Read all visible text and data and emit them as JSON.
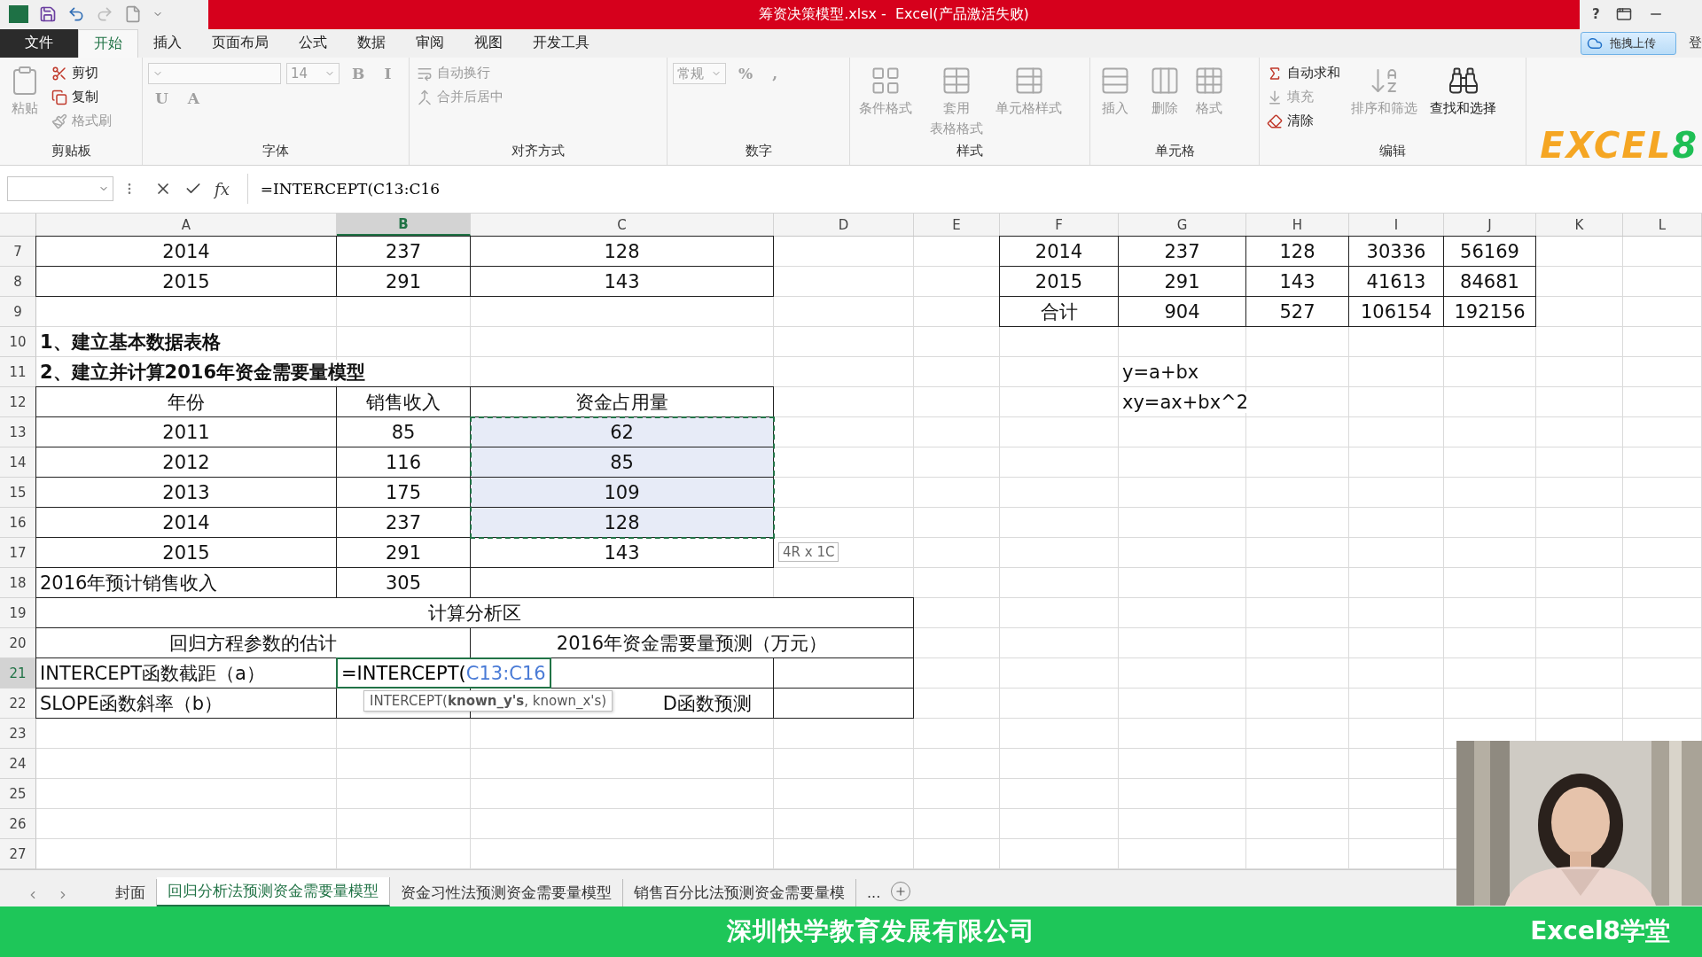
{
  "title_bar": {
    "title": "筹资决策模型.xlsx -  Excel(产品激活失败)",
    "help": "?"
  },
  "menu_tabs": [
    {
      "label": "文件",
      "kind": "file",
      "selected": false
    },
    {
      "label": "开始",
      "kind": "tab",
      "selected": true
    },
    {
      "label": "插入",
      "kind": "tab",
      "selected": false
    },
    {
      "label": "页面布局",
      "kind": "tab",
      "selected": false
    },
    {
      "label": "公式",
      "kind": "tab",
      "selected": false
    },
    {
      "label": "数据",
      "kind": "tab",
      "selected": false
    },
    {
      "label": "审阅",
      "kind": "tab",
      "selected": false
    },
    {
      "label": "视图",
      "kind": "tab",
      "selected": false
    },
    {
      "label": "开发工具",
      "kind": "tab",
      "selected": false
    }
  ],
  "upload_button": "拖拽上传",
  "account": "登",
  "ribbon": [
    {
      "label": "剪贴板",
      "items": [
        {
          "kind": "large",
          "lines": [
            "粘贴"
          ],
          "disabled": true
        },
        {
          "kind": "small",
          "label": "剪切",
          "disabled": false
        },
        {
          "kind": "small",
          "label": "复制",
          "disabled": false
        },
        {
          "kind": "small",
          "label": "格式刷",
          "disabled": true
        }
      ]
    },
    {
      "label": "字体",
      "items": [
        {
          "kind": "combo",
          "disabled": true
        },
        {
          "kind": "combo",
          "value": "14",
          "disabled": true
        },
        {
          "kind": "glyph",
          "label": "B",
          "disabled": true
        },
        {
          "kind": "glyph",
          "label": "I",
          "disabled": true
        },
        {
          "kind": "glyph",
          "label": "U",
          "disabled": true
        },
        {
          "kind": "glyph",
          "label": "A",
          "disabled": true
        }
      ]
    },
    {
      "label": "对齐方式",
      "items": [
        {
          "kind": "small",
          "label": "自动换行",
          "disabled": true
        },
        {
          "kind": "small",
          "label": "合并后居中",
          "disabled": true
        }
      ]
    },
    {
      "label": "数字",
      "items": [
        {
          "kind": "combo",
          "value": "常规",
          "disabled": true
        },
        {
          "kind": "glyph",
          "label": "%",
          "disabled": true
        },
        {
          "kind": "glyph",
          "label": ",",
          "disabled": true
        }
      ]
    },
    {
      "label": "样式",
      "items": [
        {
          "kind": "large",
          "lines": [
            "条件格式"
          ],
          "disabled": true
        },
        {
          "kind": "large",
          "lines": [
            "套用",
            "表格格式"
          ],
          "disabled": true
        },
        {
          "kind": "large",
          "lines": [
            "单元格样式"
          ],
          "disabled": true
        }
      ]
    },
    {
      "label": "单元格",
      "items": [
        {
          "kind": "large",
          "lines": [
            "插入"
          ],
          "disabled": true
        },
        {
          "kind": "large",
          "lines": [
            "删除"
          ],
          "disabled": true
        },
        {
          "kind": "large",
          "lines": [
            "格式"
          ],
          "disabled": true
        }
      ]
    },
    {
      "label": "编辑",
      "items": [
        {
          "kind": "small",
          "label": "自动求和",
          "disabled": false
        },
        {
          "kind": "small",
          "label": "填充",
          "disabled": true
        },
        {
          "kind": "small",
          "label": "清除",
          "disabled": false
        },
        {
          "kind": "large",
          "lines": [
            "排序和筛选"
          ],
          "disabled": true
        },
        {
          "kind": "large",
          "lines": [
            "查找和选择"
          ],
          "disabled": false
        }
      ]
    }
  ],
  "logo": {
    "text": "EXCEL",
    "accent": "8"
  },
  "formula_bar": {
    "fx": "fx",
    "formula": "=INTERCEPT(C13:C16"
  },
  "sheet": {
    "columns": [
      {
        "label": "A",
        "selected": false
      },
      {
        "label": "B",
        "selected": true
      },
      {
        "label": "C",
        "selected": false
      },
      {
        "label": "D",
        "selected": false
      },
      {
        "label": "E",
        "selected": false
      },
      {
        "label": "F",
        "selected": false
      },
      {
        "label": "G",
        "selected": false
      },
      {
        "label": "H",
        "selected": false
      },
      {
        "label": "I",
        "selected": false
      },
      {
        "label": "J",
        "selected": false
      },
      {
        "label": "K",
        "selected": false
      },
      {
        "label": "L",
        "selected": false
      }
    ],
    "rows": [
      {
        "number": "7",
        "selected": false,
        "cells": [
          {
            "text": "2014",
            "bordered": true
          },
          {
            "text": "237",
            "bordered": true
          },
          {
            "text": "128",
            "bordered": true
          },
          {
            "bordered": false
          },
          {
            "bordered": false
          },
          {
            "text": "2014",
            "bordered": true
          },
          {
            "text": "237",
            "bordered": true
          },
          {
            "text": "128",
            "bordered": true
          },
          {
            "text": "30336",
            "bordered": true
          },
          {
            "text": "56169",
            "bordered": true
          }
        ]
      },
      {
        "number": "8",
        "selected": false,
        "cells": [
          {
            "text": "2015",
            "bordered": true
          },
          {
            "text": "291",
            "bordered": true
          },
          {
            "text": "143",
            "bordered": true
          },
          {
            "bordered": false
          },
          {
            "bordered": false
          },
          {
            "text": "2015",
            "bordered": true
          },
          {
            "text": "291",
            "bordered": true
          },
          {
            "text": "143",
            "bordered": true
          },
          {
            "text": "41613",
            "bordered": true
          },
          {
            "text": "84681",
            "bordered": true
          }
        ]
      },
      {
        "number": "9",
        "selected": false,
        "cells": [
          {
            "bordered": false
          },
          {
            "bordered": false
          },
          {
            "bordered": false
          },
          {
            "bordered": false
          },
          {
            "bordered": false
          },
          {
            "text": "合计",
            "bordered": true
          },
          {
            "text": "904",
            "bordered": true
          },
          {
            "text": "527",
            "bordered": true
          },
          {
            "text": "106154",
            "bordered": true
          },
          {
            "text": "192156",
            "bordered": true
          }
        ]
      },
      {
        "number": "10",
        "selected": false,
        "cells": [
          {
            "text": "1、建立基本数据表格",
            "left_aligned": true,
            "bold": true
          }
        ]
      },
      {
        "number": "11",
        "selected": false,
        "cells": [
          {
            "text": "2、建立并计算2016年资金需要量模型",
            "left_aligned": true,
            "bold": true
          },
          {
            "bordered": false
          },
          {
            "bordered": false
          },
          {
            "bordered": false
          },
          {
            "bordered": false
          },
          {
            "bordered": false
          },
          {
            "text": "y=a+bx",
            "left_aligned": true
          }
        ]
      },
      {
        "number": "12",
        "selected": false,
        "cells": [
          {
            "text": "年份",
            "bordered": true
          },
          {
            "text": "销售收入",
            "bordered": true
          },
          {
            "text": "资金占用量",
            "bordered": true
          },
          {
            "bordered": false
          },
          {
            "bordered": false
          },
          {
            "bordered": false
          },
          {
            "text": "xy=ax+bx^2",
            "left_aligned": true
          }
        ]
      },
      {
        "number": "13",
        "selected": false,
        "cells": [
          {
            "text": "2011",
            "bordered": true
          },
          {
            "text": "85",
            "bordered": true
          },
          {
            "text": "62",
            "bordered": true,
            "highlighted": true
          }
        ]
      },
      {
        "number": "14",
        "selected": false,
        "cells": [
          {
            "text": "2012",
            "bordered": true
          },
          {
            "text": "116",
            "bordered": true
          },
          {
            "text": "85",
            "bordered": true,
            "highlighted": true
          }
        ]
      },
      {
        "number": "15",
        "selected": false,
        "cells": [
          {
            "text": "2013",
            "bordered": true
          },
          {
            "text": "175",
            "bordered": true
          },
          {
            "text": "109",
            "bordered": true,
            "highlighted": true
          }
        ]
      },
      {
        "number": "16",
        "selected": false,
        "cells": [
          {
            "text": "2014",
            "bordered": true
          },
          {
            "text": "237",
            "bordered": true
          },
          {
            "text": "128",
            "bordered": true,
            "highlighted": true
          }
        ]
      },
      {
        "number": "17",
        "selected": false,
        "cells": [
          {
            "text": "2015",
            "bordered": true
          },
          {
            "text": "291",
            "bordered": true
          },
          {
            "text": "143",
            "bordered": true
          }
        ]
      },
      {
        "number": "18",
        "selected": false,
        "cells": [
          {
            "text": "2016年预计销售收入",
            "left_aligned": true,
            "bordered": true
          },
          {
            "text": "305",
            "bordered": true
          }
        ]
      },
      {
        "number": "19",
        "selected": false,
        "cells": [
          {
            "text": "计算分析区",
            "bordered": true
          },
          {
            "covered": true
          },
          {
            "covered": true
          },
          {
            "covered": true
          }
        ]
      },
      {
        "number": "20",
        "selected": false,
        "cells": [
          {
            "text": "回归方程参数的估计",
            "bordered": true
          },
          {
            "covered": true
          },
          {
            "text": "2016年资金需要量预测（万元）",
            "bordered": true
          },
          {
            "covered": true
          }
        ]
      },
      {
        "number": "21",
        "selected": true,
        "cells": [
          {
            "text": "INTERCEPT函数截距（a）",
            "left_aligned": true,
            "bordered": true
          },
          {
            "kind": "editing",
            "text": "=INTERCEPT(",
            "reference": "C13:C16"
          },
          {
            "bordered": false
          },
          {
            "bordered": true
          }
        ]
      },
      {
        "number": "22",
        "selected": false,
        "cells": [
          {
            "text": "SLOPE函数斜率（b）",
            "left_aligned": true,
            "bordered": true
          },
          {
            "bordered": true
          },
          {
            "text": "D函数预测",
            "right_aligned": true,
            "bordered": true
          },
          {
            "bordered": true
          }
        ]
      },
      {
        "number": "23",
        "selected": false
      },
      {
        "number": "24",
        "selected": false
      },
      {
        "number": "25",
        "selected": false
      },
      {
        "number": "26",
        "selected": false
      },
      {
        "number": "27",
        "selected": false
      }
    ],
    "function_tooltip": "INTERCEPT(**known_y's**, known_x's)",
    "size_tip": "4R x 1C"
  },
  "sheet_tabs": [
    {
      "label": "封面",
      "selected": false
    },
    {
      "label": "回归分析法预测资金需要量模型",
      "selected": true
    },
    {
      "label": "资金习性法预测资金需要量模型",
      "selected": false
    },
    {
      "label": "销售百分比法预测资金需要量模",
      "selected": false
    }
  ],
  "more_tabs": "...",
  "banner": {
    "company": "深圳快学教育发展有限公司",
    "brand": "Excel8学堂"
  }
}
